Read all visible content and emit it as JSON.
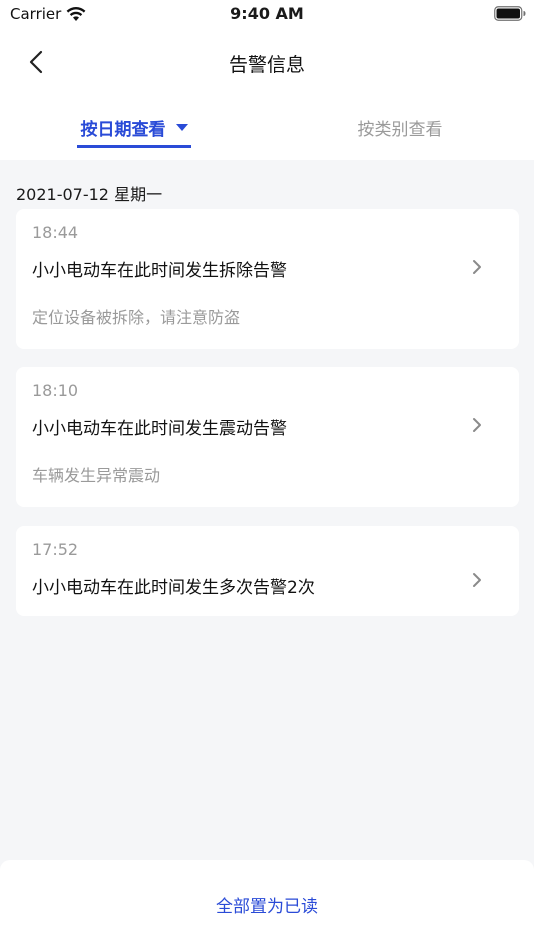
{
  "status_bar": {
    "carrier": "Carrier",
    "time": "9:40 AM",
    "icons": [
      "wifi-icon",
      "battery-icon"
    ]
  },
  "nav": {
    "title": "告警信息",
    "back_icon": "chevron-left-icon"
  },
  "tabs": [
    {
      "label": "按日期查看",
      "active": true,
      "has_dropdown": true
    },
    {
      "label": "按类别查看",
      "active": false
    }
  ],
  "date_header": "2021-07-12 星期一",
  "alerts": [
    {
      "time": "18:44",
      "title": "小小电动车在此时间发生拆除告警",
      "description": "定位设备被拆除，请注意防盗"
    },
    {
      "time": "18:10",
      "title": "小小电动车在此时间发生震动告警",
      "description": "车辆发生异常震动"
    },
    {
      "time": "17:52",
      "title": "小小电动车在此时间发生多次告警2次",
      "description": ""
    }
  ],
  "footer": {
    "mark_all_read": "全部置为已读"
  },
  "colors": {
    "accent": "#2a4bd7",
    "muted_text": "#9a9a9a",
    "background": "#f5f6f8",
    "card": "#ffffff"
  }
}
